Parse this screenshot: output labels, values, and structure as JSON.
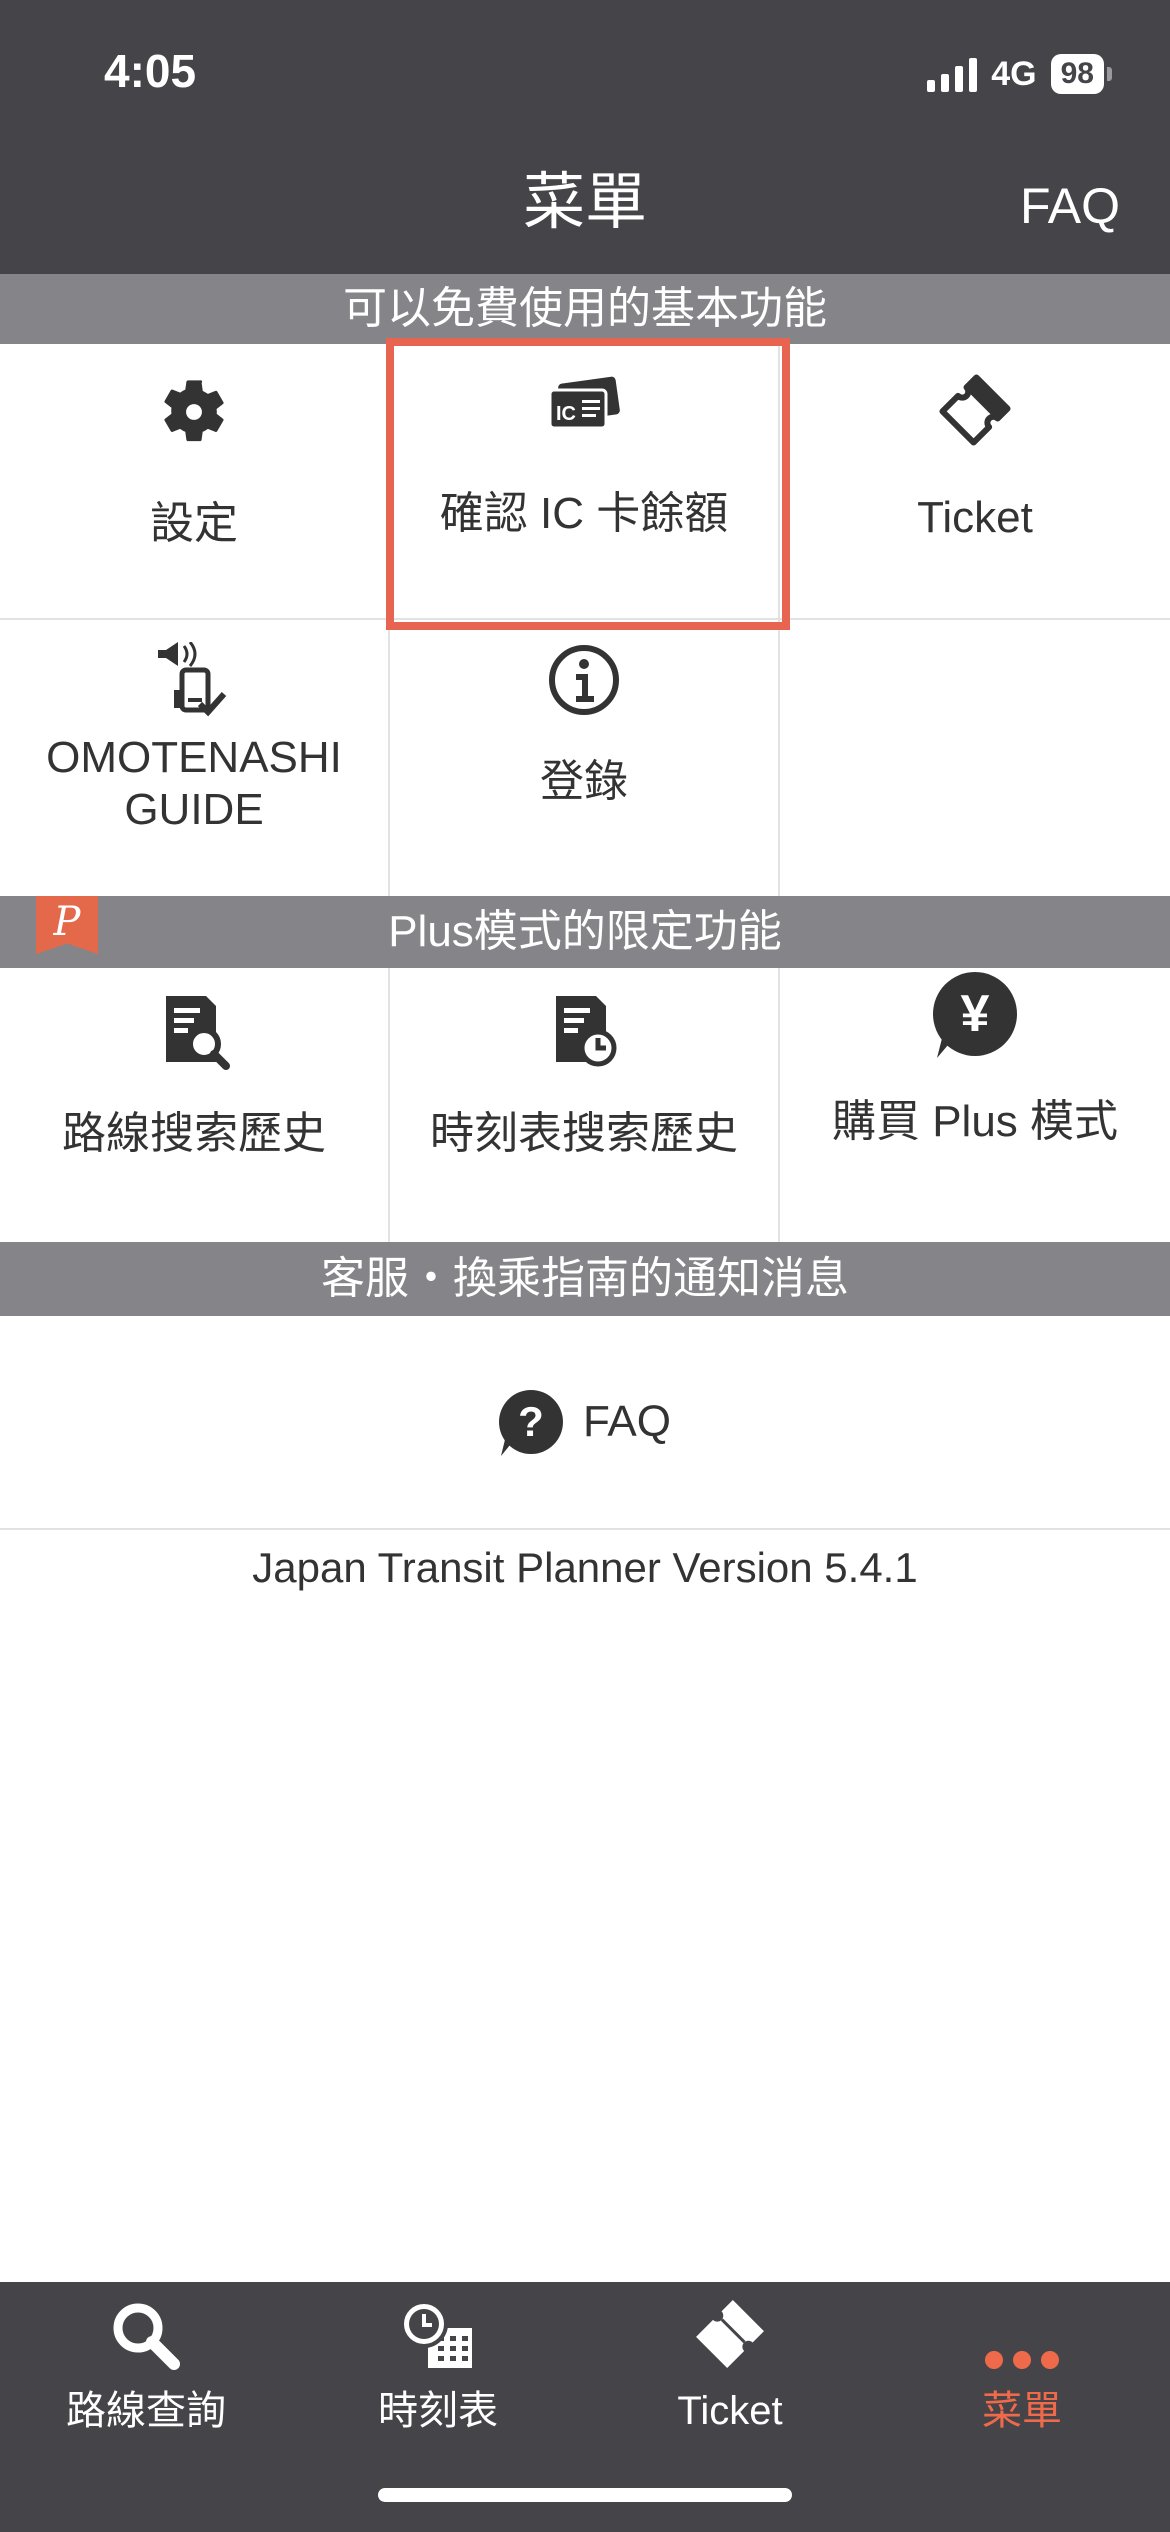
{
  "status_bar": {
    "time": "4:05",
    "network": "4G",
    "battery": "98"
  },
  "nav": {
    "title": "菜單",
    "faq": "FAQ"
  },
  "sections": {
    "free": {
      "title": "可以免費使用的基本功能"
    },
    "plus": {
      "title": "Plus模式的限定功能",
      "badge": "P"
    },
    "support": {
      "title": "客服・換乘指南的通知消息"
    }
  },
  "free_items": [
    {
      "label": "設定",
      "icon": "gear-icon"
    },
    {
      "label": "確認 IC 卡餘額",
      "icon": "ic-card-icon"
    },
    {
      "label": "Ticket",
      "icon": "ticket-icon"
    },
    {
      "label_line1": "OMOTENASHI",
      "label_line2": "GUIDE",
      "icon": "omotenashi-icon"
    },
    {
      "label": "登錄",
      "icon": "info-icon"
    }
  ],
  "plus_items": [
    {
      "label": "路線搜索歷史",
      "icon": "route-history-icon"
    },
    {
      "label": "時刻表搜索歷史",
      "icon": "timetable-history-icon"
    },
    {
      "label": "購買 Plus 模式",
      "icon": "yen-icon",
      "glyph": "¥"
    }
  ],
  "faq_item": {
    "label": "FAQ",
    "icon": "question-icon",
    "glyph": "?"
  },
  "version": "Japan Transit Planner Version 5.4.1",
  "tabs": [
    {
      "label": "路線查詢",
      "icon": "search-icon"
    },
    {
      "label": "時刻表",
      "icon": "timetable-icon"
    },
    {
      "label": "Ticket",
      "icon": "ticket-icon"
    },
    {
      "label": "菜單",
      "icon": "more-icon",
      "active": true
    }
  ],
  "colors": {
    "bar": "#454449",
    "section": "#858489",
    "accent": "#ef6a4a",
    "highlight": "#e76550"
  }
}
